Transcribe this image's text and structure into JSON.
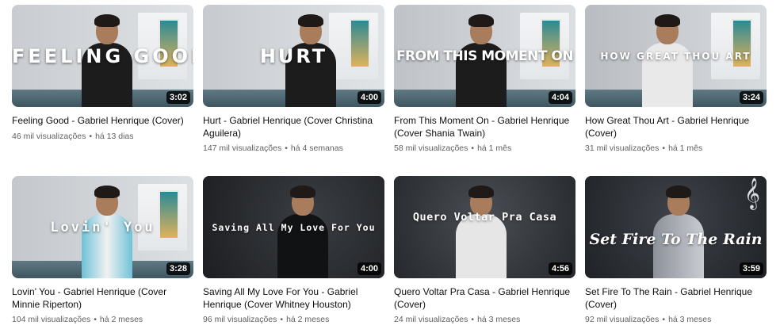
{
  "videos": [
    {
      "overlay": "FEELING GOOD",
      "duration": "3:02",
      "title": "Feeling Good - Gabriel Henrique (Cover)",
      "views": "46 mil visualizações",
      "age": "há 13 dias"
    },
    {
      "overlay": "HURT",
      "duration": "4:00",
      "title": "Hurt - Gabriel Henrique (Cover Christina Aguilera)",
      "views": "147 mil visualizações",
      "age": "há 4 semanas"
    },
    {
      "overlay": "FROM THIS MOMENT ON",
      "duration": "4:04",
      "title": "From This Moment On - Gabriel Henrique (Cover Shania Twain)",
      "views": "58 mil visualizações",
      "age": "há 1 mês"
    },
    {
      "overlay": "HOW GREAT THOU ART",
      "duration": "3:24",
      "title": "How Great Thou Art - Gabriel Henrique (Cover)",
      "views": "31 mil visualizações",
      "age": "há 1 mês"
    },
    {
      "overlay": "Lovin' You",
      "duration": "3:28",
      "title": "Lovin' You - Gabriel Henrique (Cover Minnie Riperton)",
      "views": "104 mil visualizações",
      "age": "há 2 meses"
    },
    {
      "overlay": "Saving All My Love For You",
      "duration": "4:00",
      "title": "Saving All My Love For You - Gabriel Henrique (Cover Whitney Houston)",
      "views": "96 mil visualizações",
      "age": "há 2 meses"
    },
    {
      "overlay": "Quero Voltar Pra Casa",
      "duration": "4:56",
      "title": "Quero Voltar Pra Casa - Gabriel Henrique (Cover)",
      "views": "24 mil visualizações",
      "age": "há 3 meses"
    },
    {
      "overlay": "Set Fire To The Rain",
      "duration": "3:59",
      "title": "Set Fire To The Rain - Gabriel Henrique (Cover)",
      "views": "92 mil visualizações",
      "age": "há 3 meses"
    }
  ],
  "meta_separator": "•",
  "clef_glyph": "𝄞"
}
